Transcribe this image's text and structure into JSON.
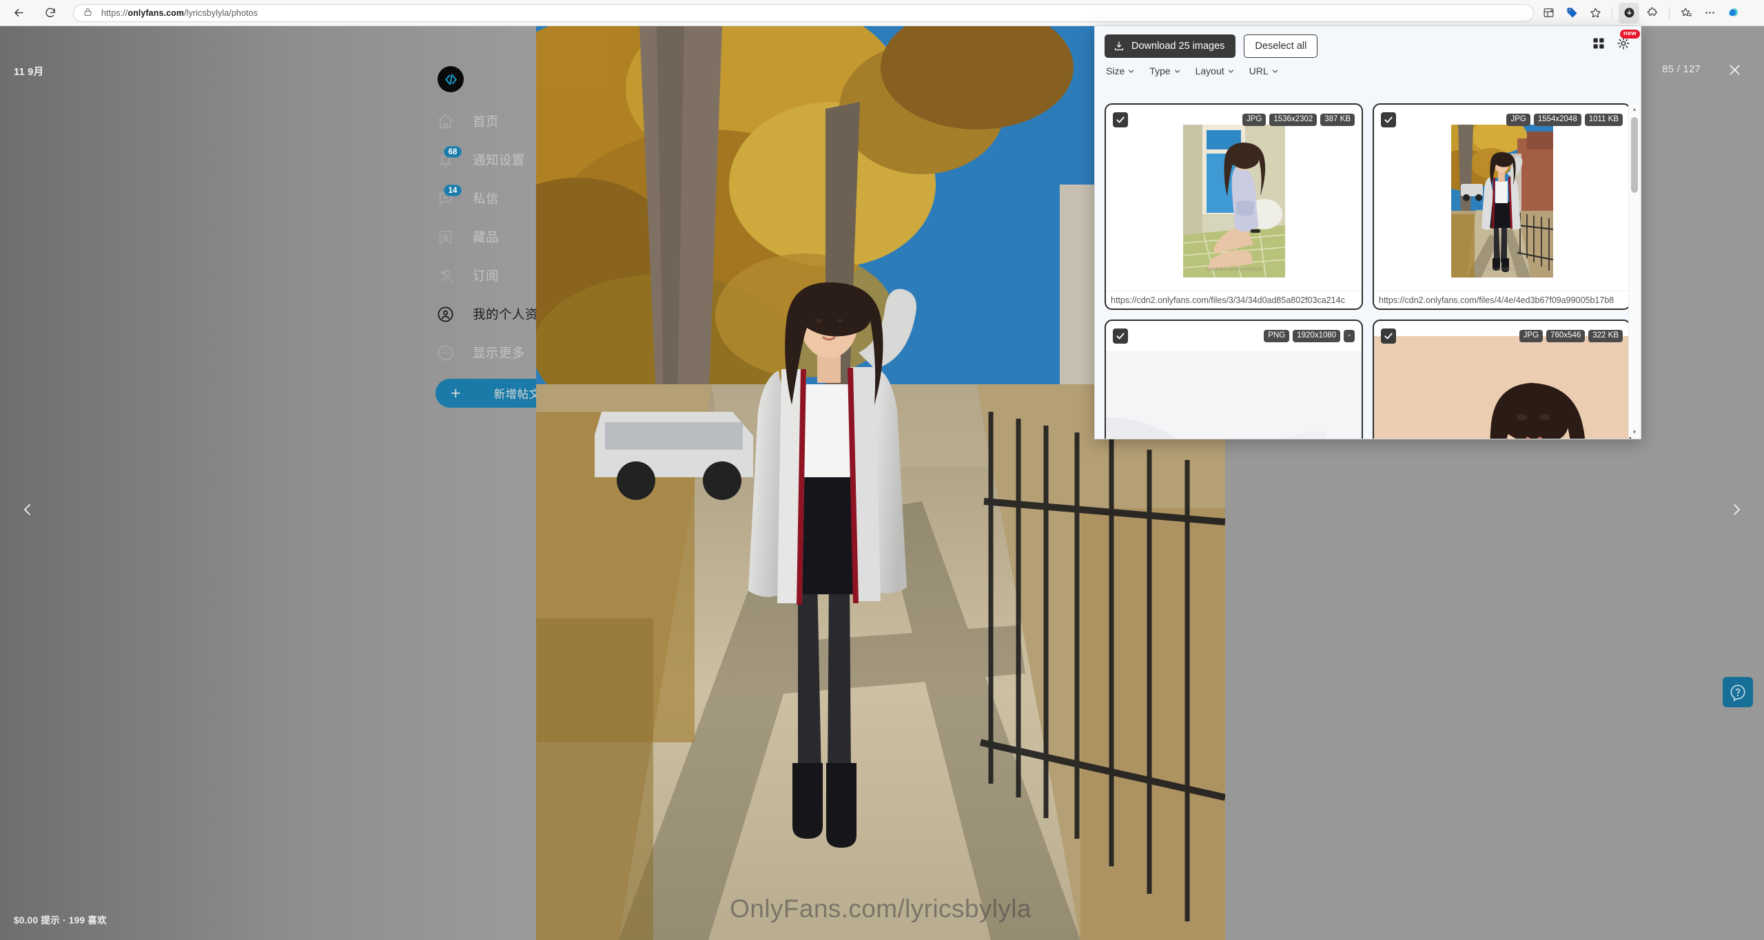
{
  "browser": {
    "url_prefix": "https://",
    "url_domain": "onlyfans.com",
    "url_path": "/lyricsbylyla/photos",
    "back_icon": "back-arrow-icon",
    "reload_icon": "reload-icon",
    "lock_icon": "lock-icon"
  },
  "viewer": {
    "date": "11 9月",
    "counter": "85 / 127",
    "watermark": "OnlyFans.com/lyricsbylyla",
    "status": "$0.00 提示 · 199 喜欢",
    "prev_label": "‹",
    "next_label": "›",
    "close_label": "✕",
    "new_post_label": "新增帖文",
    "new_post_plus": "+",
    "accent_color": "#1a7aa8"
  },
  "sidebar": {
    "items": [
      {
        "label": "首页",
        "icon": "home-icon",
        "badge": ""
      },
      {
        "label": "通知设置",
        "icon": "bell-icon",
        "badge": "68"
      },
      {
        "label": "私信",
        "icon": "message-icon",
        "badge": "14"
      },
      {
        "label": "藏品",
        "icon": "bookmark-star-icon",
        "badge": ""
      },
      {
        "label": "订阅",
        "icon": "user-heart-icon",
        "badge": ""
      },
      {
        "label": "我的个人资",
        "icon": "profile-circle-icon",
        "badge": ""
      },
      {
        "label": "显示更多",
        "icon": "more-dots-icon",
        "badge": ""
      }
    ]
  },
  "extension": {
    "download_label": "Download 25 images",
    "download_icon": "download-icon",
    "deselect_label": "Deselect all",
    "grid_icon": "grid-view-icon",
    "gear_icon": "gear-icon",
    "new_badge": "new",
    "filters": [
      {
        "label": "Size"
      },
      {
        "label": "Type"
      },
      {
        "label": "Layout"
      },
      {
        "label": "URL"
      }
    ],
    "cards": [
      {
        "checked": true,
        "format": "JPG",
        "dimensions": "1536x2302",
        "filesize": "387 KB",
        "url": "https://cdn2.onlyfans.com/files/3/34/34d0ad85a802f03ca214c",
        "thumb_watermark": "OnlyFans.com/lyricsbylyla",
        "thumb_kind": "portrait-indoor"
      },
      {
        "checked": true,
        "format": "JPG",
        "dimensions": "1554x2048",
        "filesize": "1011 KB",
        "url": "https://cdn2.onlyfans.com/files/4/4e/4ed3b67f09a99005b17b8",
        "thumb_watermark": "OnlyFans.com/lyricsbylyla",
        "thumb_kind": "portrait-street"
      },
      {
        "checked": true,
        "format": "PNG",
        "dimensions": "1920x1080",
        "filesize": "-",
        "url": "",
        "thumb_watermark": "",
        "thumb_kind": "blank-placeholder"
      },
      {
        "checked": true,
        "format": "JPG",
        "dimensions": "760x546",
        "filesize": "322 KB",
        "url": "",
        "thumb_watermark": "",
        "thumb_kind": "portrait-beige"
      }
    ],
    "scrollbar": {
      "up": "▲",
      "down": "▼"
    }
  }
}
